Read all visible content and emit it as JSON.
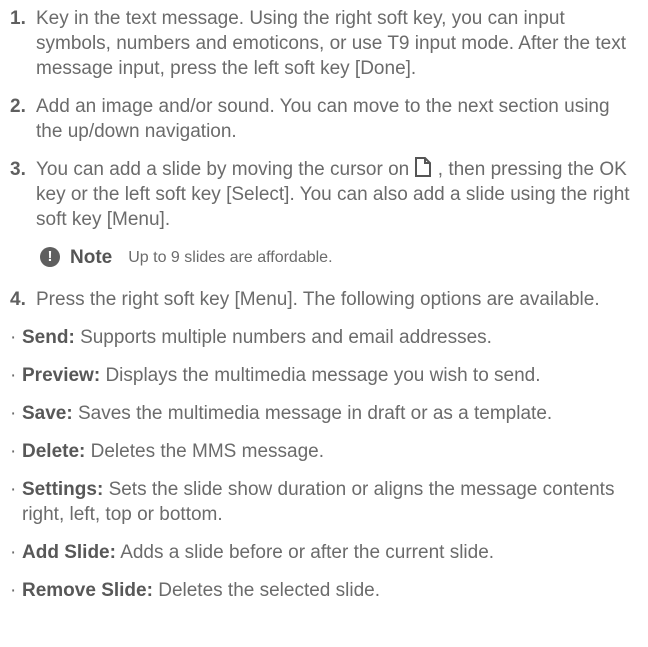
{
  "steps": [
    {
      "num": "1.",
      "text": "Key in the text message. Using the right soft key, you can input symbols, numbers and emoticons, or use T9 input mode. After the text message input, press the left soft key [Done]."
    },
    {
      "num": "2.",
      "text": "Add an image and/or sound. You can move to the next section using the up/down navigation."
    },
    {
      "num": "3.",
      "text_before": "You can add a slide by moving the cursor on",
      "icon": "new-slide-icon",
      "text_after": ", then pressing the OK key or the left soft key [Select]. You can also add a slide using the right soft key [Menu]."
    },
    {
      "num": "4.",
      "text": "Press the right soft key [Menu]. The following options are available."
    }
  ],
  "note": {
    "icon": "exclamation-icon",
    "label": "Note",
    "text": "Up to 9 slides are affordable."
  },
  "options": [
    {
      "term": "Send:",
      "desc": "Supports multiple numbers and email addresses."
    },
    {
      "term": "Preview:",
      "desc": "Displays the multimedia message you wish to send."
    },
    {
      "term": "Save:",
      "desc": "Saves the multimedia message in draft or as a template."
    },
    {
      "term": "Delete:",
      "desc": "Deletes the MMS message."
    },
    {
      "term": "Settings:",
      "desc": "Sets the slide show duration or aligns the message contents right, left, top or bottom."
    },
    {
      "term": "Add Slide:",
      "desc": "Adds a slide before or after the current slide."
    },
    {
      "term": "Remove Slide:",
      "desc": "Deletes the selected slide."
    }
  ]
}
